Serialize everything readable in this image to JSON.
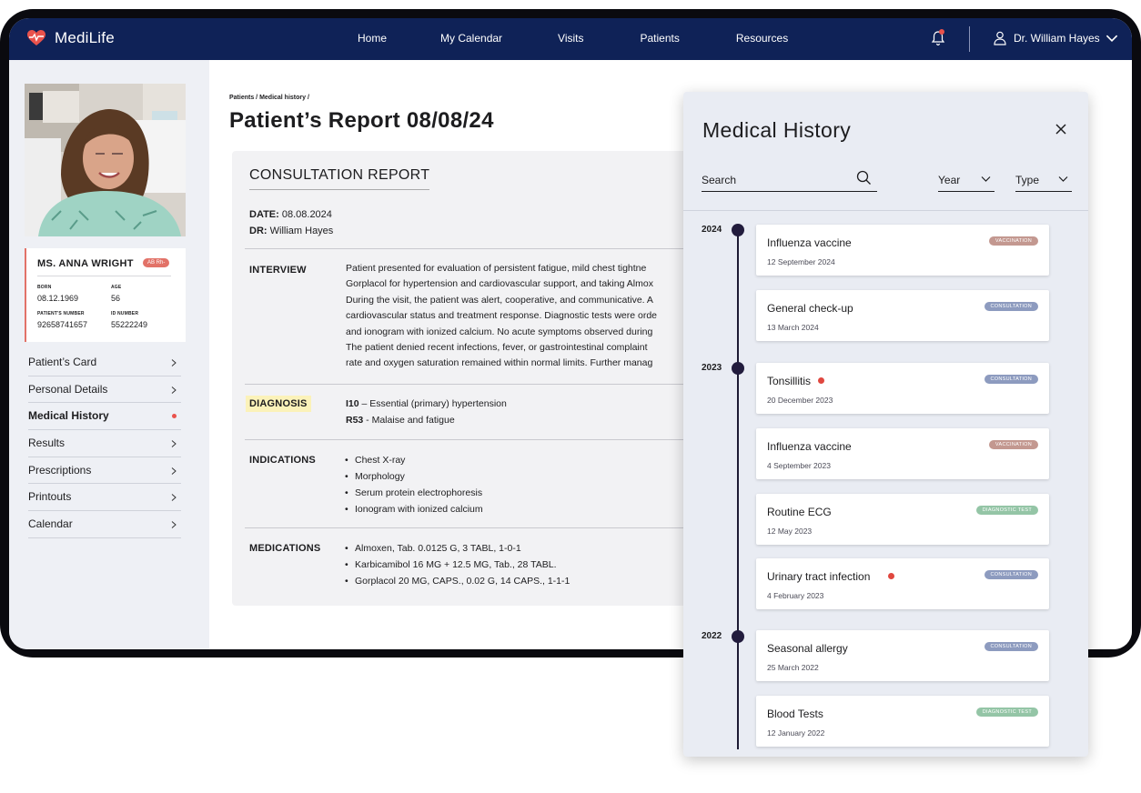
{
  "app": {
    "name": "MediLife"
  },
  "nav": {
    "links": [
      "Home",
      "My Calendar",
      "Visits",
      "Patients",
      "Resources"
    ],
    "user_name": "Dr. William Hayes"
  },
  "patient": {
    "name": "MS. ANNA WRIGHT",
    "blood_type": "AB Rh-",
    "born_label": "BORN",
    "born": "08.12.1969",
    "age_label": "AGE",
    "age": "56",
    "patient_number_label": "PATIENT'S NUMBER",
    "patient_number": "92658741657",
    "id_number_label": "ID NUMBER",
    "id_number": "55222249"
  },
  "sidebar_menu": [
    {
      "label": "Patient’s Card"
    },
    {
      "label": "Personal Details"
    },
    {
      "label": "Medical History",
      "active": true
    },
    {
      "label": "Results"
    },
    {
      "label": "Prescriptions"
    },
    {
      "label": "Printouts"
    },
    {
      "label": "Calendar"
    }
  ],
  "main": {
    "breadcrumb": "Patients / Medical history /",
    "title": "Patient’s Report 08/08/24"
  },
  "report": {
    "title": "CONSULTATION REPORT",
    "date_label": "DATE:",
    "date": "08.08.2024",
    "dr_label": "DR:",
    "dr": "William Hayes",
    "interview_label": "INTERVIEW",
    "interview_lines": [
      "Patient presented for evaluation of persistent fatigue, mild chest tightne",
      "Gorplacol for hypertension and cardiovascular support, and taking Almox",
      "During the visit, the patient was alert, cooperative, and communicative. A",
      "cardiovascular status and treatment response. Diagnostic tests were orde",
      "and ionogram with ionized calcium. No acute symptoms observed during",
      "The patient denied recent infections, fever, or gastrointestinal complaint",
      "rate and oxygen saturation remained within normal limits. Further manag"
    ],
    "diagnosis_label": "DIAGNOSIS",
    "diagnoses": [
      {
        "code": "I10",
        "text": " – Essential (primary) hypertension"
      },
      {
        "code": "R53",
        "text": " - Malaise and fatigue"
      }
    ],
    "indications_label": "INDICATIONS",
    "indications": [
      "Chest X-ray",
      "Morphology",
      "Serum protein electrophoresis",
      "Ionogram with ionized calcium"
    ],
    "medications_label": "MEDICATIONS",
    "medications": [
      "Almoxen, Tab. 0.0125 G, 3 TABL, 1-0-1",
      "Karbicamibol 16 MG + 12.5 MG, Tab., 28 TABL.",
      "Gorplacol 20 MG, CAPS., 0.02 G, 14 CAPS., 1-1-1"
    ]
  },
  "history_panel": {
    "title": "Medical History",
    "search_placeholder": "Search",
    "year_filter": "Year",
    "type_filter": "Type",
    "badge_colors": {
      "VACCINATION": "#c39890",
      "CONSULTATION": "#8d9bbf",
      "DIAGNOSTIC TEST": "#94c5a6"
    },
    "years": [
      "2024",
      "2023",
      "2022"
    ],
    "entries": [
      {
        "title": "Influenza vaccine",
        "date": "12 September 2024",
        "type": "VACCINATION",
        "flag": false
      },
      {
        "title": "General check-up",
        "date": "13 March 2024",
        "type": "CONSULTATION",
        "flag": false
      },
      {
        "title": "Tonsillitis",
        "date": "20 December 2023",
        "type": "CONSULTATION",
        "flag": true
      },
      {
        "title": "Influenza vaccine",
        "date": "4 September 2023",
        "type": "VACCINATION",
        "flag": false
      },
      {
        "title": "Routine ECG",
        "date": "12 May 2023",
        "type": "DIAGNOSTIC TEST",
        "flag": false
      },
      {
        "title": "Urinary tract infection",
        "date": "4 February 2023",
        "type": "CONSULTATION",
        "flag": true
      },
      {
        "title": "Seasonal allergy",
        "date": "25 March 2022",
        "type": "CONSULTATION",
        "flag": false
      },
      {
        "title": "Blood Tests",
        "date": "12 January 2022",
        "type": "DIAGNOSTIC TEST",
        "flag": false
      }
    ]
  }
}
